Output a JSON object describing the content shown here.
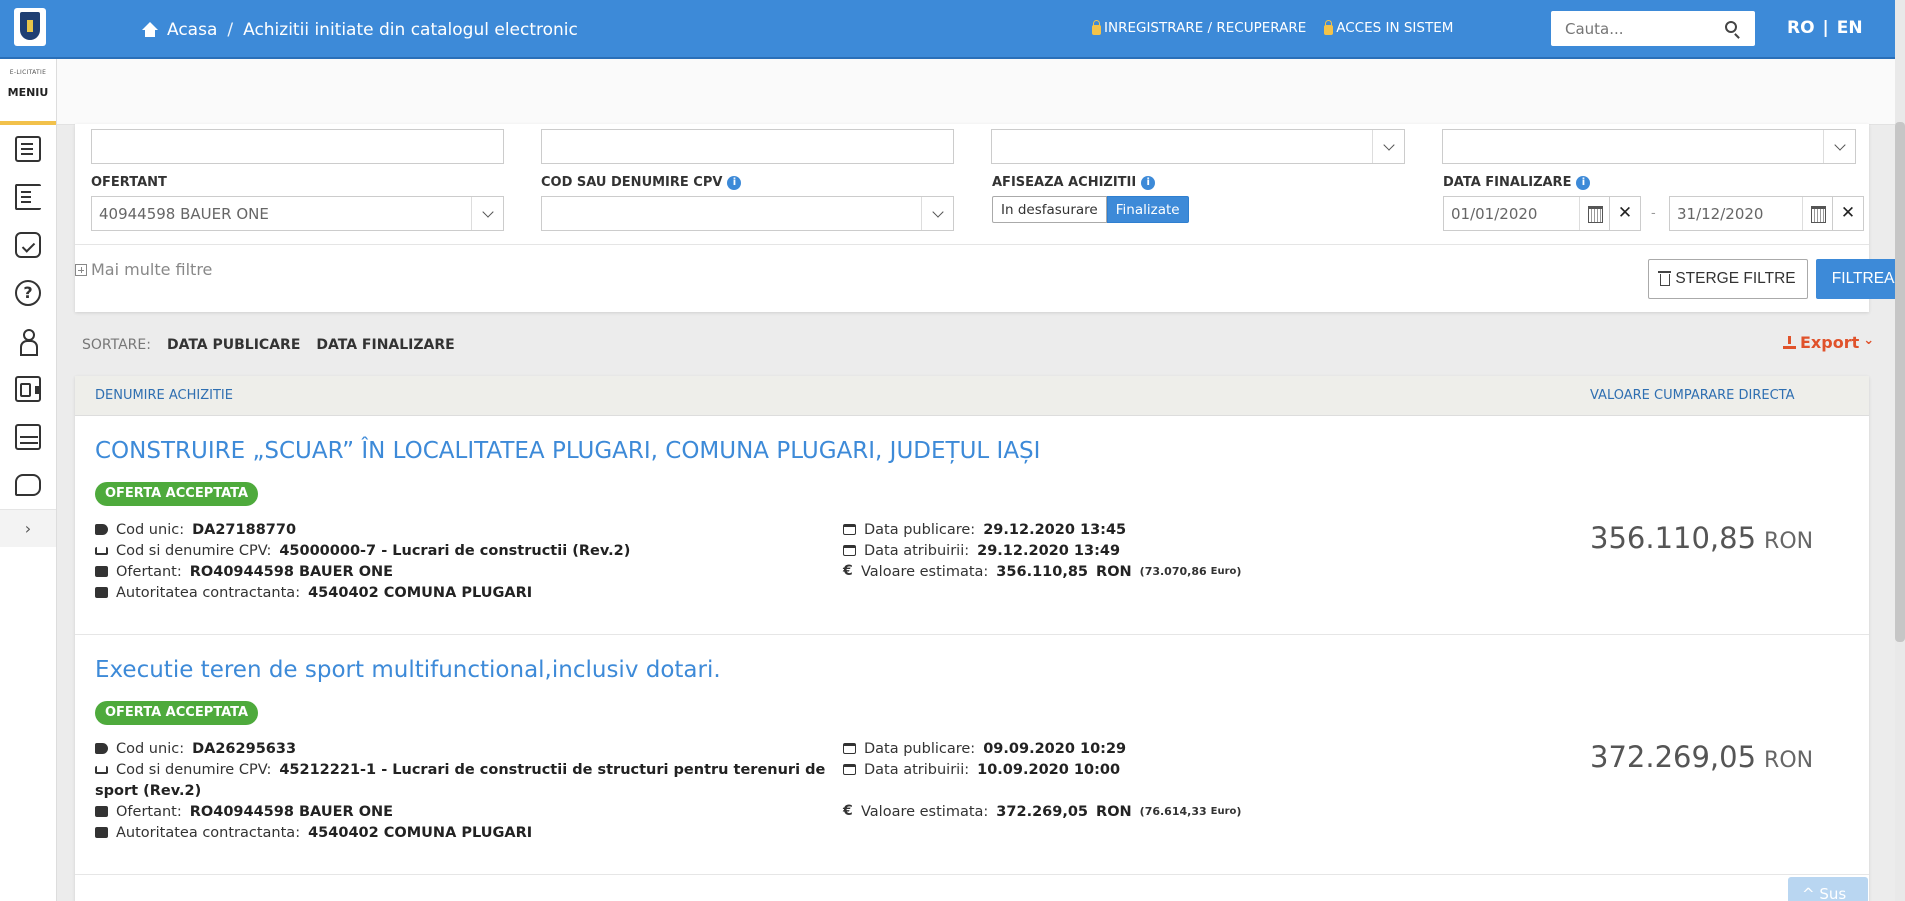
{
  "header": {
    "home": "Acasa",
    "separator": "/",
    "page": "Achizitii initiate din catalogul electronic",
    "register": "INREGISTRARE / RECUPERARE",
    "login": "ACCES IN SISTEM",
    "search_placeholder": "Cauta...",
    "lang_ro": "RO",
    "lang_sep": "|",
    "lang_en": "EN"
  },
  "menu": {
    "small": "E-LICITATIE",
    "title": "MENIU",
    "expand": "›",
    "icons": [
      "document-icon",
      "list-icon",
      "checklist-icon",
      "help-icon",
      "person-icon",
      "id-card-icon",
      "grid-icon",
      "chat-icon"
    ]
  },
  "filters": {
    "ofertant_label": "OFERTANT",
    "ofertant_value": "40944598 BAUER ONE",
    "cpv_label": "COD SAU DENUMIRE CPV",
    "cpv_value": "",
    "afiseaza_label": "AFISEAZA ACHIZITII",
    "option_running": "In desfasurare",
    "option_finished": "Finalizate",
    "data_label": "DATA FINALIZARE",
    "date_from": "01/01/2020",
    "date_to": "31/12/2020",
    "date_dash": "-",
    "clear_x": "✕",
    "more_filters": "Mai multe filtre",
    "clear_button": "STERGE FILTRE",
    "filter_button": "FILTREAZA",
    "info": "i"
  },
  "sort": {
    "label": "SORTARE:",
    "option1": "DATA PUBLICARE",
    "option2": "DATA FINALIZARE",
    "export": "Export",
    "export_chev": "⌄"
  },
  "table": {
    "col_name": "DENUMIRE ACHIZITIE",
    "col_value": "VALOARE CUMPARARE DIRECTA"
  },
  "labels": {
    "cod_unic": "Cod unic:",
    "cpv": "Cod si denumire CPV:",
    "ofertant": "Ofertant:",
    "autoritatea": "Autoritatea contractanta:",
    "data_publicare": "Data publicare:",
    "data_atribuirii": "Data atribuirii:",
    "valoare": "Valoare estimata:",
    "currency": "RON",
    "euro": "Euro",
    "euro_symbol": "€"
  },
  "results": [
    {
      "title": "CONSTRUIRE „SCUAR” ÎN LOCALITATEA PLUGARI, COMUNA PLUGARI, JUDEȚUL IAȘI",
      "badge": "OFERTA ACCEPTATA",
      "cod_unic": "DA27188770",
      "cpv": "45000000-7 - Lucrari de constructii (Rev.2)",
      "cpv_cont": "",
      "ofertant": "RO40944598 BAUER ONE",
      "autoritatea": "4540402 COMUNA PLUGARI",
      "data_publicare": "29.12.2020 13:45",
      "data_atribuirii": "29.12.2020 13:49",
      "valoare": "356.110,85",
      "valoare_euro": "(73.070,86",
      "price": "356.110,85"
    },
    {
      "title": "Executie teren de sport multifunctional,inclusiv dotari.",
      "badge": "OFERTA ACCEPTATA",
      "cod_unic": "DA26295633",
      "cpv": "45212221-1 - Lucrari de constructii de structuri pentru terenuri de",
      "cpv_cont": "sport (Rev.2)",
      "ofertant": "RO40944598 BAUER ONE",
      "autoritatea": "4540402 COMUNA PLUGARI",
      "data_publicare": "09.09.2020 10:29",
      "data_atribuirii": "10.09.2020 10:00",
      "valoare": "372.269,05",
      "valoare_euro": "(76.614,33",
      "price": "372.269,05"
    }
  ],
  "scroll_top": "^ Sus"
}
